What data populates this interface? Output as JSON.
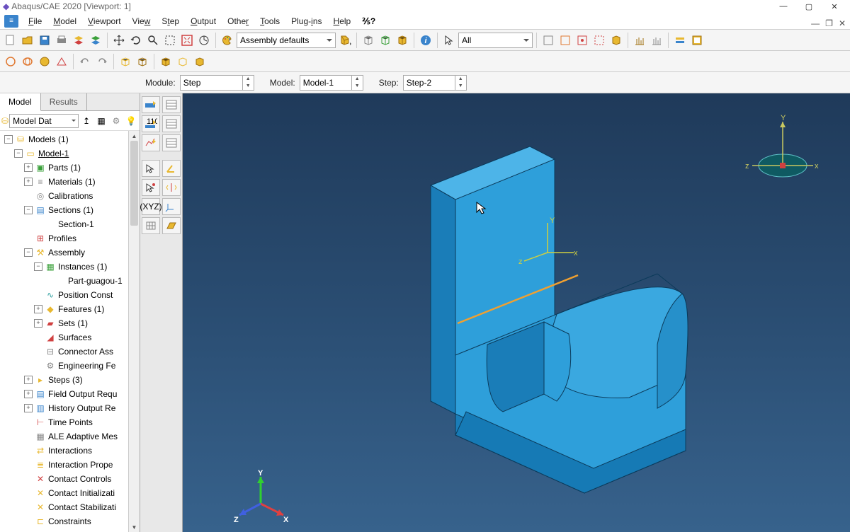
{
  "title": "Abaqus/CAE 2020 [Viewport: 1]",
  "menus": [
    "File",
    "Model",
    "Viewport",
    "View",
    "Step",
    "Output",
    "Other",
    "Tools",
    "Plug-ins",
    "Help"
  ],
  "assembly_combo": "Assembly defaults",
  "filter_combo": "All",
  "context": {
    "module_label": "Module:",
    "module_value": "Step",
    "model_label": "Model:",
    "model_value": "Model-1",
    "step_label": "Step:",
    "step_value": "Step-2"
  },
  "tabs": {
    "model": "Model",
    "results": "Results"
  },
  "tree_filter": "Model Dat",
  "tree": [
    {
      "indent": 1,
      "exp": "-",
      "ico": "models",
      "label": "Models (1)"
    },
    {
      "indent": 2,
      "exp": "-",
      "ico": "model",
      "label": "Model-1",
      "current": true
    },
    {
      "indent": 3,
      "exp": "+",
      "ico": "parts",
      "label": "Parts (1)"
    },
    {
      "indent": 3,
      "exp": "+",
      "ico": "mat",
      "label": "Materials (1)"
    },
    {
      "indent": 3,
      "exp": "",
      "ico": "cal",
      "label": "Calibrations"
    },
    {
      "indent": 3,
      "exp": "-",
      "ico": "sec",
      "label": "Sections (1)"
    },
    {
      "indent": 4,
      "exp": "",
      "ico": "",
      "label": "Section-1"
    },
    {
      "indent": 3,
      "exp": "",
      "ico": "prof",
      "label": "Profiles"
    },
    {
      "indent": 3,
      "exp": "-",
      "ico": "asm",
      "label": "Assembly"
    },
    {
      "indent": 4,
      "exp": "-",
      "ico": "inst",
      "label": "Instances (1)"
    },
    {
      "indent": 5,
      "exp": "",
      "ico": "",
      "label": "Part-guagou-1"
    },
    {
      "indent": 4,
      "exp": "",
      "ico": "pos",
      "label": "Position Const"
    },
    {
      "indent": 4,
      "exp": "+",
      "ico": "feat",
      "label": "Features (1)"
    },
    {
      "indent": 4,
      "exp": "+",
      "ico": "sets",
      "label": "Sets (1)"
    },
    {
      "indent": 4,
      "exp": "",
      "ico": "surf",
      "label": "Surfaces"
    },
    {
      "indent": 4,
      "exp": "",
      "ico": "conn",
      "label": "Connector Ass"
    },
    {
      "indent": 4,
      "exp": "",
      "ico": "eng",
      "label": "Engineering Fe"
    },
    {
      "indent": 3,
      "exp": "+",
      "ico": "steps",
      "label": "Steps (3)"
    },
    {
      "indent": 3,
      "exp": "+",
      "ico": "for",
      "label": "Field Output Requ"
    },
    {
      "indent": 3,
      "exp": "+",
      "ico": "hor",
      "label": "History Output Re"
    },
    {
      "indent": 3,
      "exp": "",
      "ico": "tp",
      "label": "Time Points"
    },
    {
      "indent": 3,
      "exp": "",
      "ico": "ale",
      "label": "ALE Adaptive Mes"
    },
    {
      "indent": 3,
      "exp": "",
      "ico": "int",
      "label": "Interactions"
    },
    {
      "indent": 3,
      "exp": "",
      "ico": "intp",
      "label": "Interaction Prope"
    },
    {
      "indent": 3,
      "exp": "",
      "ico": "cc",
      "label": "Contact Controls"
    },
    {
      "indent": 3,
      "exp": "",
      "ico": "ci",
      "label": "Contact Initializati"
    },
    {
      "indent": 3,
      "exp": "",
      "ico": "cs",
      "label": "Contact Stabilizati"
    },
    {
      "indent": 3,
      "exp": "",
      "ico": "con",
      "label": "Constraints"
    }
  ],
  "axes": {
    "x": "X",
    "y": "Y",
    "z": "Z"
  },
  "axes_lower": {
    "x": "x",
    "y": "y",
    "z": "z"
  },
  "icon_colors": {
    "blue": "#3a84cc",
    "yellow": "#e8b830",
    "green": "#3aa03a",
    "red": "#d04040",
    "orange": "#e07830",
    "teal": "#30a0a0",
    "purple": "#8050c0",
    "gray": "#999"
  },
  "model_color": "#2e9fda",
  "model_edge": "#0b3a5a",
  "highlight": "#f0a030"
}
